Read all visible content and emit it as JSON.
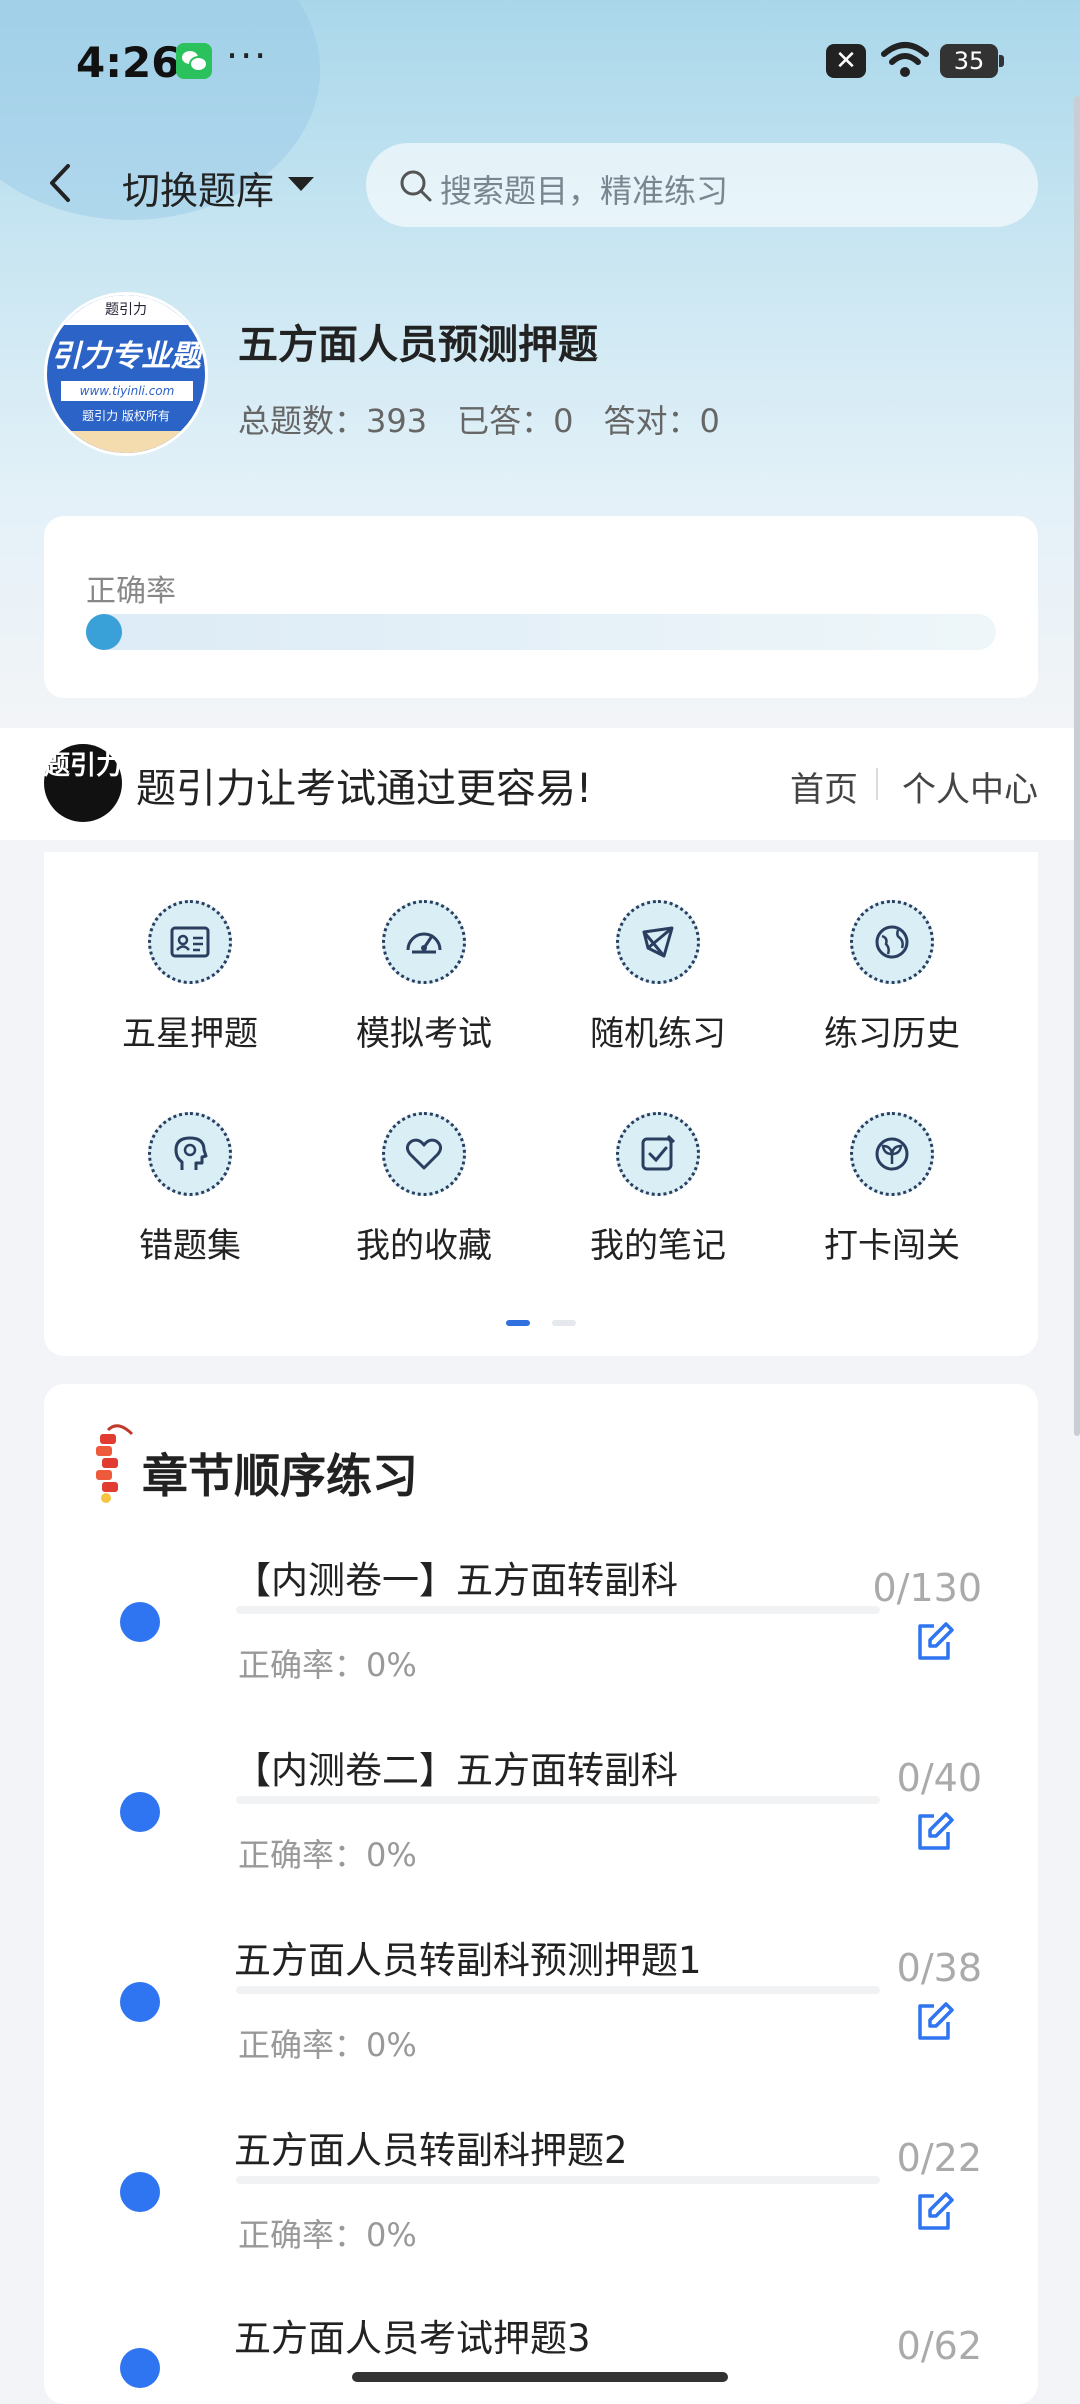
{
  "status_bar": {
    "time": "4:26",
    "dots": "···",
    "battery": "35"
  },
  "header": {
    "switch_label": "切换题库",
    "search_placeholder": "搜索题目，精准练习"
  },
  "bank": {
    "logo_top": "题引力",
    "logo_main": "引力专业题",
    "logo_url": "www.tiyinli.com",
    "logo_copy": "题引力 版权所有",
    "title": "五方面人员预测押题",
    "total": "总题数：393",
    "answered": "已答：0",
    "correct": "答对：0"
  },
  "accuracy": {
    "label": "正确率",
    "value_percent": 0
  },
  "promo": {
    "logo_text": "题引力",
    "text": "题引力让考试通过更容易!",
    "home": "首页",
    "me": "个人中心"
  },
  "grid": {
    "items": [
      {
        "label": "五星押题",
        "icon": "id-card-icon"
      },
      {
        "label": "模拟考试",
        "icon": "gauge-icon"
      },
      {
        "label": "随机练习",
        "icon": "random-icon"
      },
      {
        "label": "练习历史",
        "icon": "globe-icon"
      },
      {
        "label": "错题集",
        "icon": "head-icon"
      },
      {
        "label": "我的收藏",
        "icon": "heart-icon"
      },
      {
        "label": "我的笔记",
        "icon": "note-check-icon"
      },
      {
        "label": "打卡闯关",
        "icon": "sprout-icon"
      }
    ],
    "page_current": 1,
    "page_count": 2
  },
  "chapters": {
    "title": "章节顺序练习",
    "items": [
      {
        "name": "【内测卷一】五方面转副科",
        "accuracy": "正确率：0%",
        "count": "0/130"
      },
      {
        "name": "【内测卷二】五方面转副科",
        "accuracy": "正确率：0%",
        "count": "0/40"
      },
      {
        "name": "五方面人员转副科预测押题1",
        "accuracy": "正确率：0%",
        "count": "0/38"
      },
      {
        "name": "五方面人员转副科押题2",
        "accuracy": "正确率：0%",
        "count": "0/22"
      },
      {
        "name": "五方面人员考试押题3",
        "accuracy": "",
        "count": "0/62"
      }
    ]
  },
  "colors": {
    "accent": "#2f74f0",
    "progress": "#3aa0d8",
    "icon_bg": "#d9eef5"
  }
}
